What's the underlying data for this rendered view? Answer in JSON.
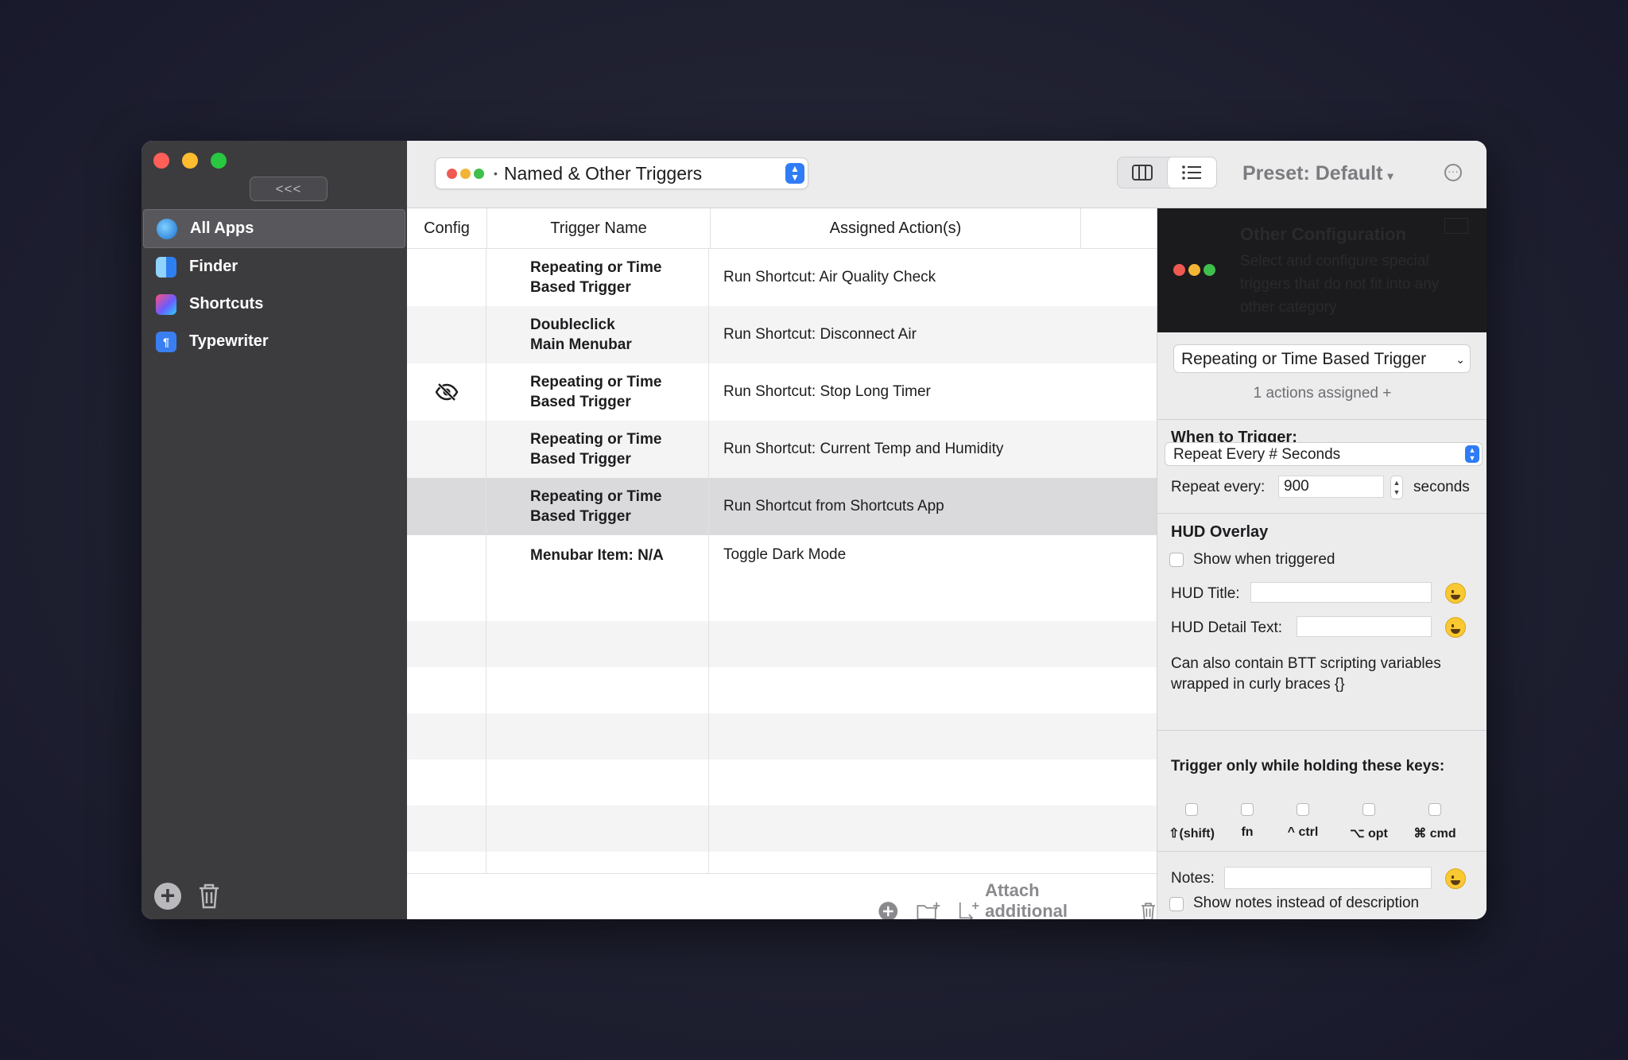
{
  "sidebar": {
    "collapse_label": "<<<",
    "apps": [
      {
        "label": "All Apps",
        "icon": "globe-icon"
      },
      {
        "label": "Finder",
        "icon": "finder-icon"
      },
      {
        "label": "Shortcuts",
        "icon": "shortcuts-icon"
      },
      {
        "label": "Typewriter",
        "icon": "typewriter-icon"
      }
    ]
  },
  "toolbar": {
    "group_label": "Named & Other Triggers",
    "preset_label": "Preset: Default",
    "preset_caret": "▾"
  },
  "table": {
    "headers": {
      "config": "Config",
      "trigger": "Trigger Name",
      "action": "Assigned Action(s)"
    },
    "rows": [
      {
        "trigger_line1": "Repeating or Time",
        "trigger_line2": "Based Trigger",
        "action": "Run Shortcut: Air Quality Check",
        "hidden": false,
        "selected": false
      },
      {
        "trigger_line1": "Doubleclick",
        "trigger_line2": "Main Menubar",
        "action": "Run Shortcut: Disconnect Air",
        "hidden": false,
        "selected": false
      },
      {
        "trigger_line1": "Repeating or Time",
        "trigger_line2": "Based Trigger",
        "action": "Run Shortcut: Stop Long Timer",
        "hidden": true,
        "selected": false
      },
      {
        "trigger_line1": "Repeating or Time",
        "trigger_line2": "Based Trigger",
        "action": "Run Shortcut: Current Temp and Humidity",
        "hidden": false,
        "selected": false
      },
      {
        "trigger_line1": "Repeating or Time",
        "trigger_line2": "Based Trigger",
        "action": "Run Shortcut from Shortcuts App",
        "hidden": false,
        "selected": true
      },
      {
        "trigger_line1": "Menubar Item: N/A",
        "trigger_line2": "",
        "action": "Toggle Dark Mode",
        "hidden": false,
        "selected": false
      }
    ],
    "footer": {
      "attach_label": "Attach additional action"
    }
  },
  "panel": {
    "other_config_title": "Other Configuration",
    "other_config_desc": "Select and configure special triggers that do not fit into any other category",
    "trigger_type": "Repeating or Time Based Trigger",
    "actions_assigned": "1 actions assigned +",
    "when_label": "When to Trigger:",
    "repeat_mode": "Repeat Every # Seconds",
    "repeat_every_label": "Repeat every:",
    "repeat_value": "900",
    "seconds_label": "seconds",
    "hud_heading": "HUD Overlay",
    "show_when_triggered": "Show when triggered",
    "hud_title_label": "HUD Title:",
    "hud_detail_label": "HUD Detail Text:",
    "hud_note": "Can also contain BTT scripting variables wrapped in curly braces {}",
    "keys_heading": "Trigger only while holding these keys:",
    "keys": [
      "⇧(shift)",
      "fn",
      "^ ctrl",
      "⌥ opt",
      "⌘ cmd"
    ],
    "notes_label": "Notes:",
    "show_notes_label": "Show notes instead of description"
  },
  "colors": {
    "accent": "#2f7cf6",
    "sidebar_bg": "#3c3c3f",
    "selected_row": "#dadadc"
  }
}
